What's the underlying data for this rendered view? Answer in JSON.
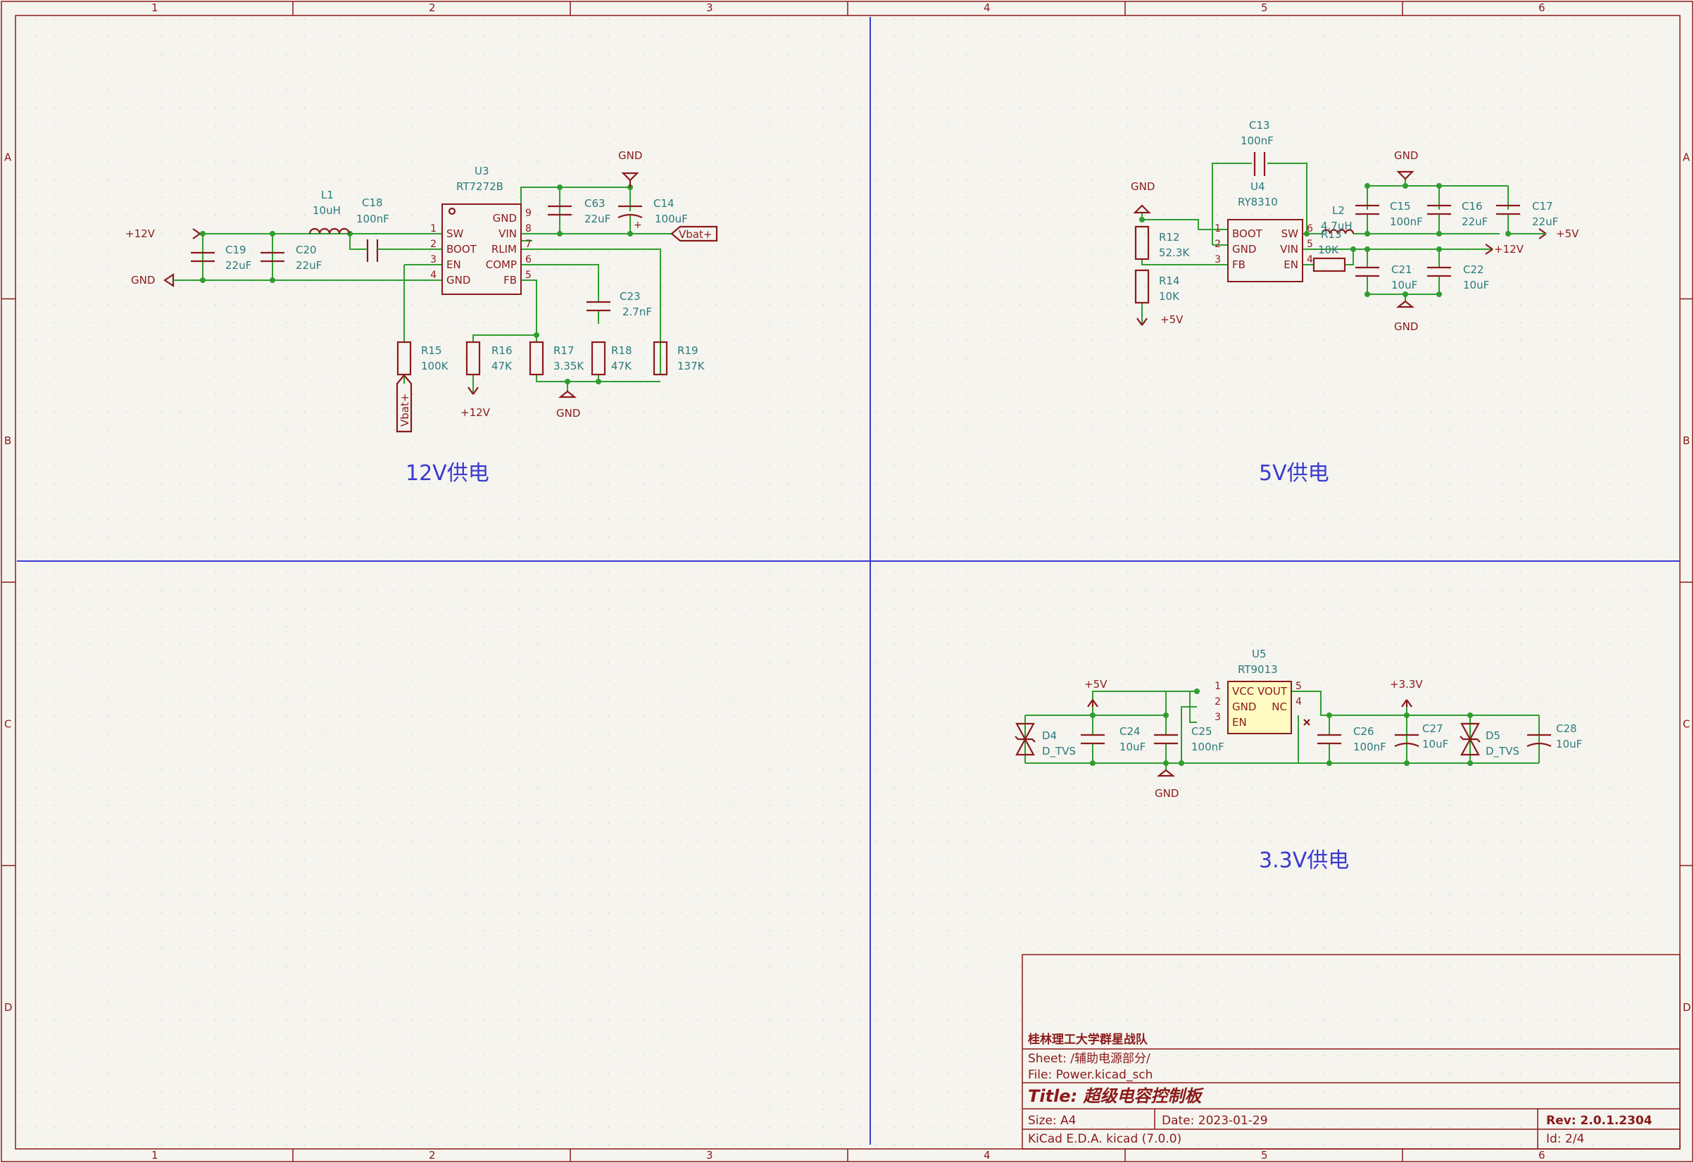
{
  "frame": {
    "columns": [
      "1",
      "2",
      "3",
      "4",
      "5",
      "6"
    ],
    "rows": [
      "A",
      "B",
      "C",
      "D"
    ]
  },
  "sections": {
    "s12v": "12V供电",
    "s5v": "5V供电",
    "s33v": "3.3V供电"
  },
  "nets": {
    "p12v": "+12V",
    "p5v": "+5V",
    "p33v": "+3.3V",
    "gnd": "GND",
    "vbat": "Vbat+"
  },
  "u3": {
    "ref": "U3",
    "value": "RT7272B",
    "pins_left": [
      [
        "1",
        "SW"
      ],
      [
        "2",
        "BOOT"
      ],
      [
        "3",
        "EN"
      ],
      [
        "4",
        "GND"
      ]
    ],
    "pins_right": [
      [
        "9",
        "GND"
      ],
      [
        "8",
        "VIN"
      ],
      [
        "7",
        "RLIM"
      ],
      [
        "6",
        "COMP"
      ],
      [
        "5",
        "FB"
      ]
    ]
  },
  "u4": {
    "ref": "U4",
    "value": "RY8310",
    "pins_left": [
      [
        "1",
        "BOOT"
      ],
      [
        "2",
        "GND"
      ],
      [
        "3",
        "FB"
      ]
    ],
    "pins_right": [
      [
        "6",
        "SW"
      ],
      [
        "5",
        "VIN"
      ],
      [
        "4",
        "EN"
      ]
    ]
  },
  "u5": {
    "ref": "U5",
    "value": "RT9013",
    "pins_left": [
      [
        "1",
        "VCC"
      ],
      [
        "2",
        "GND"
      ],
      [
        "3",
        "EN"
      ]
    ],
    "pins_right": [
      [
        "5",
        "VOUT"
      ],
      [
        "4",
        "NC"
      ]
    ]
  },
  "parts": {
    "L1": [
      "L1",
      "10uH"
    ],
    "C18": [
      "C18",
      "100nF"
    ],
    "C19": [
      "C19",
      "22uF"
    ],
    "C20": [
      "C20",
      "22uF"
    ],
    "C63": [
      "C63",
      "22uF"
    ],
    "C14": [
      "C14",
      "100uF"
    ],
    "C23": [
      "C23",
      "2.7nF"
    ],
    "R15": [
      "R15",
      "100K"
    ],
    "R16": [
      "R16",
      "47K"
    ],
    "R17": [
      "R17",
      "3.35K"
    ],
    "R18": [
      "R18",
      "47K"
    ],
    "R19": [
      "R19",
      "137K"
    ],
    "C13": [
      "C13",
      "100nF"
    ],
    "R12": [
      "R12",
      "52.3K"
    ],
    "R14": [
      "R14",
      "10K"
    ],
    "L2": [
      "L2",
      "4.7uH"
    ],
    "R13": [
      "R13",
      "10K"
    ],
    "C15": [
      "C15",
      "100nF"
    ],
    "C16": [
      "C16",
      "22uF"
    ],
    "C17": [
      "C17",
      "22uF"
    ],
    "C21": [
      "C21",
      "10uF"
    ],
    "C22": [
      "C22",
      "10uF"
    ],
    "D4": [
      "D4",
      "D_TVS"
    ],
    "C24": [
      "C24",
      "10uF"
    ],
    "C25": [
      "C25",
      "100nF"
    ],
    "C26": [
      "C26",
      "100nF"
    ],
    "C27": [
      "C27",
      "10uF"
    ],
    "D5": [
      "D5",
      "D_TVS"
    ],
    "C28": [
      "C28",
      "10uF"
    ]
  },
  "title_block": {
    "org": "桂林理工大学群星战队",
    "sheet": "Sheet: /辅助电源部分/",
    "file": "File: Power.kicad_sch",
    "title": "Title: 超级电容控制板",
    "size": "Size: A4",
    "date": "Date: 2023-01-29",
    "rev": "Rev: 2.0.1.2304",
    "tool": "KiCad E.D.A.  kicad (7.0.0)",
    "id": "Id: 2/4"
  }
}
